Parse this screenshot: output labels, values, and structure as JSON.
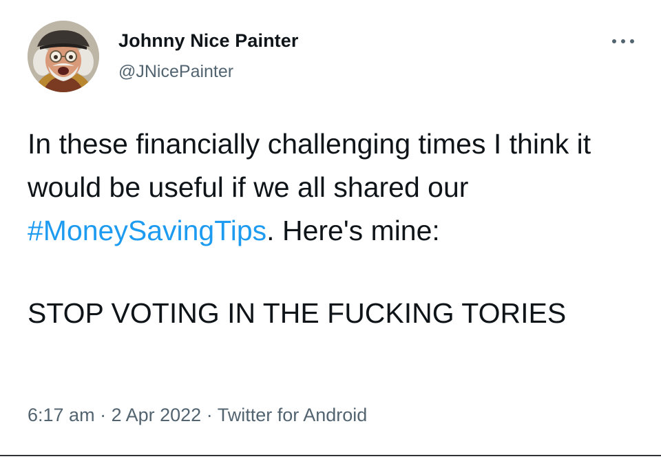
{
  "tweet": {
    "author": {
      "display_name": "Johnny Nice Painter",
      "handle": "@JNicePainter"
    },
    "menu_icon": "more-horizontal-icon",
    "text": {
      "part1": "In these financially challenging times I think it would be useful if we all shared our ",
      "hashtag": "#MoneySavingTips",
      "part2": ". Here's mine:",
      "shout": "STOP VOTING IN THE FUCKING TORIES"
    },
    "meta": {
      "time": "6:17 am",
      "separator1": " · ",
      "date": "2 Apr 2022",
      "separator2": " · ",
      "source": "Twitter for Android"
    }
  },
  "colors": {
    "text": "#0f1419",
    "secondary": "#536471",
    "link": "#1d9bf0"
  }
}
